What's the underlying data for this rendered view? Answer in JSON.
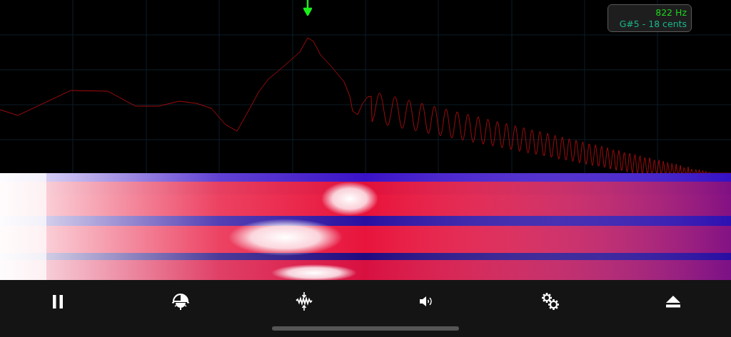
{
  "readout": {
    "frequency": "822 Hz",
    "note": "G#5 - 18 cents"
  },
  "toolbar": [
    {
      "kind": "pause"
    },
    {
      "kind": "brightness"
    },
    {
      "kind": "waveform"
    },
    {
      "kind": "volume"
    },
    {
      "kind": "settings"
    },
    {
      "kind": "eject"
    }
  ]
}
